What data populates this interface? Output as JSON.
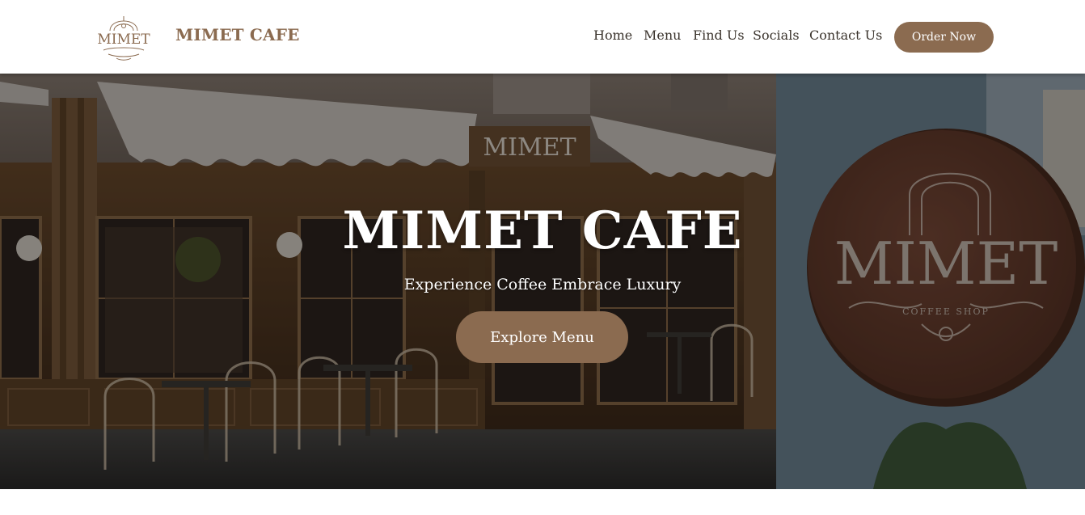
{
  "header": {
    "logo_text": "MIMET",
    "brand": "MIMET CAFE",
    "nav": [
      {
        "label": "Home"
      },
      {
        "label": "Menu"
      },
      {
        "label": "Find Us"
      },
      {
        "label": "Socials"
      },
      {
        "label": "Contact Us"
      }
    ],
    "order_button": "Order Now"
  },
  "hero": {
    "title": "MIMET CAFE",
    "subtitle": "Experience Coffee Embrace Luxury",
    "cta": "Explore Menu",
    "storefront_sign": "MIMET",
    "round_sign": "MIMET",
    "round_sign_caption": "COFFEE SHOP"
  },
  "colors": {
    "accent": "#8b6b50",
    "nav_text": "#3a332c",
    "hero_text": "#ffffff"
  }
}
